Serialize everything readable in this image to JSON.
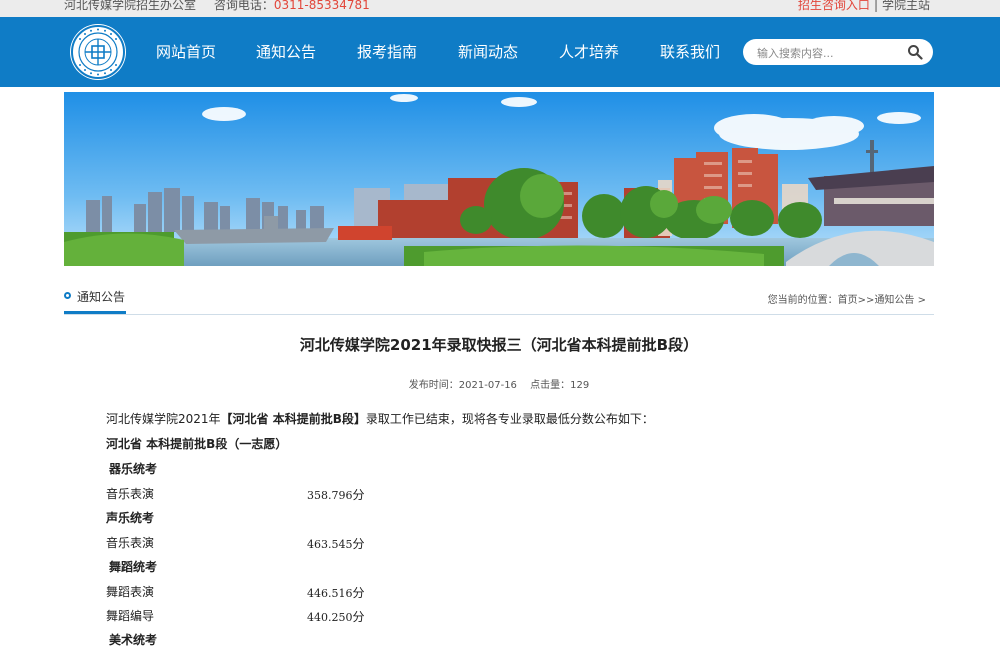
{
  "topbar": {
    "office": "河北传媒学院招生办公室",
    "consult_label": "咨询电话：",
    "phone": "0311-85334781",
    "links": [
      {
        "label": "招生咨询入口",
        "hot": true
      },
      {
        "label": "学院主站",
        "hot": false
      }
    ],
    "separator": "|"
  },
  "nav": {
    "items": [
      "网站首页",
      "通知公告",
      "报考指南",
      "新闻动态",
      "人才培养",
      "联系我们"
    ],
    "search_placeholder": "输入搜索内容..."
  },
  "section": {
    "title": "通知公告",
    "breadcrumb_prefix": "您当前的位置：",
    "breadcrumb_home": "首页",
    "breadcrumb_sep": ">>",
    "breadcrumb_current": "通知公告 >"
  },
  "article": {
    "title": "河北传媒学院2021年录取快报三（河北省本科提前批B段）",
    "publish_label": "发布时间：",
    "publish_date": "2021-07-16",
    "hits_label": "点击量：",
    "hits": "129",
    "intro_pre": "河北传媒学院2021年",
    "intro_bold": "【河北省  本科提前批B段】",
    "intro_post": "录取工作已结束，现将各专业录取最低分数公布如下：",
    "batch_heading": "河北省  本科提前批B段（一志愿）",
    "unit": "分",
    "groups": [
      {
        "name": "器乐统考",
        "rows": [
          {
            "major": "音乐表演",
            "score": "358.796"
          }
        ]
      },
      {
        "name": "声乐统考",
        "rows": [
          {
            "major": "音乐表演",
            "score": "463.545"
          }
        ]
      },
      {
        "name": "舞蹈统考",
        "rows": [
          {
            "major": "舞蹈表演",
            "score": "446.516"
          },
          {
            "major": "舞蹈编导",
            "score": "440.250"
          }
        ]
      },
      {
        "name": "美术统考",
        "rows": []
      }
    ]
  },
  "colors": {
    "nav_blue": "#0f7cc6",
    "accent_red": "#e2463a",
    "top_strip": "#ececec"
  }
}
